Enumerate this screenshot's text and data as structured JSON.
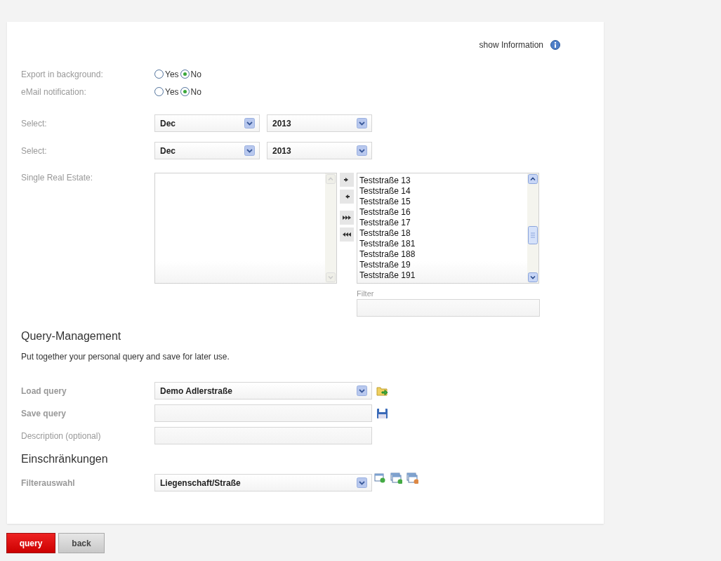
{
  "info_link": "show Information",
  "options": [
    {
      "label": "Export in background:",
      "choices": [
        {
          "label": "Yes",
          "selected": false
        },
        {
          "label": "No",
          "selected": true
        }
      ]
    },
    {
      "label": "eMail notification:",
      "choices": [
        {
          "label": "Yes",
          "selected": false
        },
        {
          "label": "No",
          "selected": true
        }
      ]
    }
  ],
  "date_selects": [
    {
      "label": "Select:",
      "month": "Dec",
      "year": "2013"
    },
    {
      "label": "Select:",
      "month": "Dec",
      "year": "2013"
    }
  ],
  "real_estate": {
    "label": "Single Real Estate:",
    "chosen": [
      "Teststraße 13",
      "Teststraße 14",
      "Teststraße 15",
      "Teststraße 16",
      "Teststraße 17",
      "Teststraße 18",
      "Teststraße 181",
      "Teststraße 188",
      "Teststraße 19",
      "Teststraße 191"
    ],
    "filter_label": "Filter"
  },
  "query_management": {
    "title": "Query-Management",
    "description": "Put together your personal query and save for later use.",
    "load_label": "Load query",
    "load_value": "Demo Adlerstraße",
    "save_label": "Save query",
    "description_label": "Description (optional)"
  },
  "restrictions": {
    "title": "Einschränkungen",
    "filter_label": "Filterauswahl",
    "filter_value": "Liegenschaft/Straße"
  },
  "buttons": [
    {
      "label": "query",
      "kind": "primary"
    },
    {
      "label": "back",
      "kind": "secondary"
    }
  ]
}
